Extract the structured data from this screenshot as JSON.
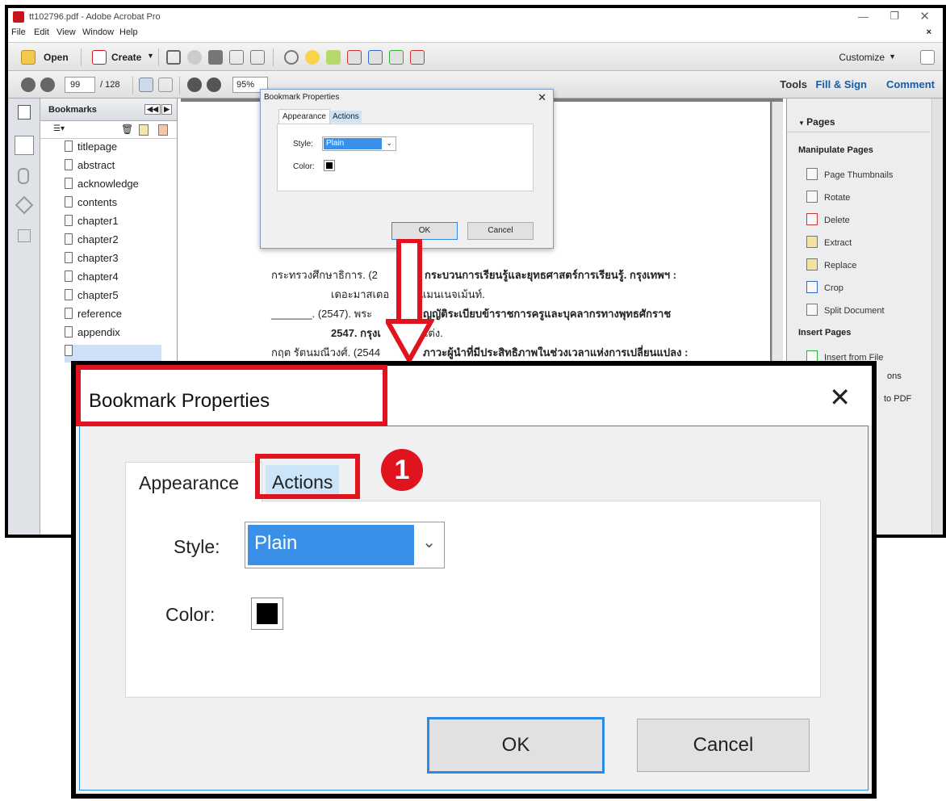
{
  "window": {
    "title": "tt102796.pdf - Adobe Acrobat Pro",
    "menu": [
      "File",
      "Edit",
      "View",
      "Window",
      "Help"
    ]
  },
  "toolbar": {
    "open": "Open",
    "create": "Create",
    "customize": "Customize"
  },
  "nav": {
    "page": "99",
    "total": "/ 128",
    "zoom": "95%",
    "tools": "Tools",
    "fill_sign": "Fill & Sign",
    "comment": "Comment"
  },
  "bookmarks": {
    "title": "Bookmarks",
    "items": [
      "titlepage",
      "abstract",
      "acknowledge",
      "contents",
      "chapter1",
      "chapter2",
      "chapter3",
      "chapter4",
      "chapter5",
      "reference",
      "appendix"
    ]
  },
  "doc": {
    "lines": [
      "กระทรวงศึกษาธิการ. (2",
      "กระบวนการเรียนรู้และยุทธศาสตร์การเรียนรู้. กรุงเทพฯ :",
      "เดอะมาสเตอ",
      "แมนเนจเม้นท์.",
      "_______. (2547). พระ",
      "ญญัติระเบียบข้าราชการครูและบุคลากรทางพุทธศักราช",
      "2547. กรุงเ",
      "แต่ง.",
      "กฤต รัตนมณีวงศ์. (2544",
      "ภาวะผู้นำที่มีประสิทธิภาพในช่วงเวลาแห่งการเปลี่ยนแปลง :"
    ]
  },
  "pages_panel": {
    "header": "Pages",
    "manipulate": "Manipulate Pages",
    "items": [
      "Page Thumbnails",
      "Rotate",
      "Delete",
      "Extract",
      "Replace",
      "Crop",
      "Split Document"
    ],
    "insert": "Insert Pages",
    "insert_items": [
      "Insert from File"
    ],
    "partial": [
      "ons",
      "to PDF"
    ]
  },
  "dialog": {
    "title": "Bookmark Properties",
    "tab_appearance": "Appearance",
    "tab_actions": "Actions",
    "style_label": "Style:",
    "style_value": "Plain",
    "color_label": "Color:",
    "ok": "OK",
    "cancel": "Cancel"
  },
  "callout": {
    "number": "1"
  },
  "colors": {
    "accent": "#2b8ae6",
    "highlight": "#e0141f",
    "selected": "#3a8fe8"
  }
}
